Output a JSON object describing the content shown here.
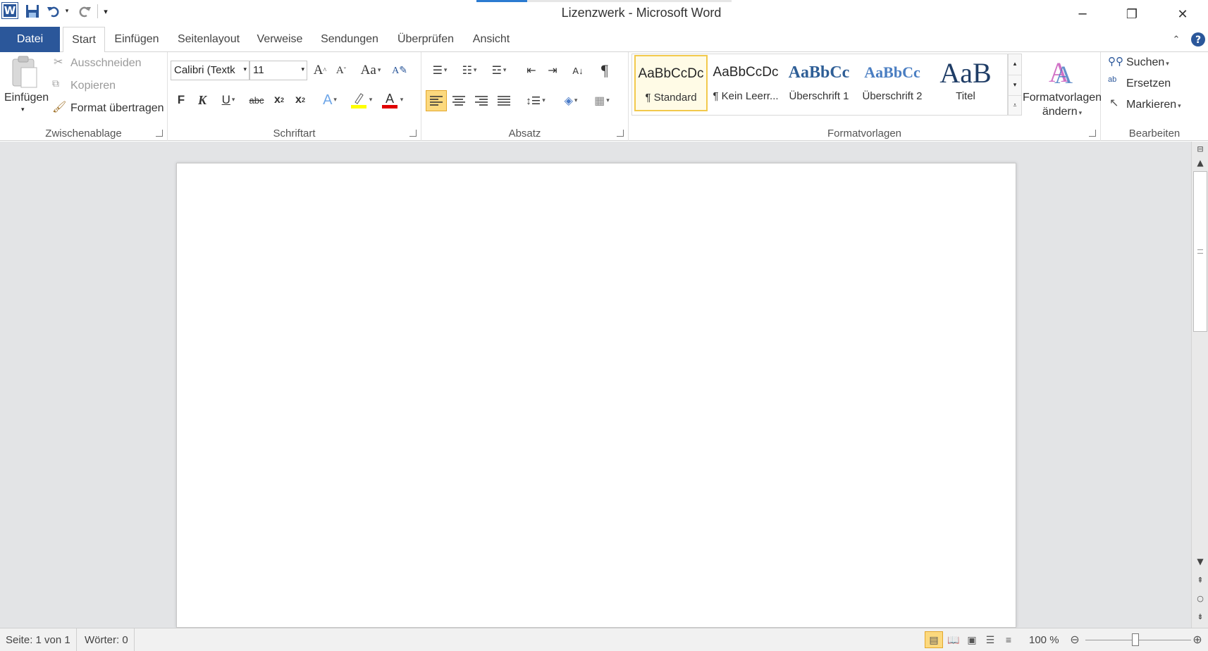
{
  "window": {
    "title": "Lizenzwerk - Microsoft Word"
  },
  "qat": {
    "logo": "W",
    "save_icon": "save-icon",
    "undo_icon": "undo-icon",
    "redo_icon": "redo-icon"
  },
  "tabs": {
    "file": "Datei",
    "items": [
      "Start",
      "Einfügen",
      "Seitenlayout",
      "Verweise",
      "Sendungen",
      "Überprüfen",
      "Ansicht"
    ],
    "active": "Start"
  },
  "clipboard": {
    "paste": "Einfügen",
    "cut": "Ausschneiden",
    "copy": "Kopieren",
    "format_painter": "Format übertragen",
    "label": "Zwischenablage"
  },
  "font": {
    "name": "Calibri (Textk",
    "size": "11",
    "label": "Schriftart",
    "bold": "F",
    "italic": "K",
    "underline": "U",
    "strike": "abc",
    "subscript": "x",
    "superscript": "x",
    "grow": "A",
    "shrink": "A",
    "case": "Aa",
    "font_color": "#e00000",
    "highlight_color": "#ffff00"
  },
  "paragraph": {
    "label": "Absatz",
    "pilcrow": "¶"
  },
  "styles": {
    "label": "Formatvorlagen",
    "items": [
      {
        "preview": "AaBbCcDc",
        "name": "¶ Standard"
      },
      {
        "preview": "AaBbCcDc",
        "name": "¶ Kein Leerr..."
      },
      {
        "preview": "AaBbCc",
        "name": "Überschrift 1"
      },
      {
        "preview": "AaBbCc",
        "name": "Überschrift 2"
      },
      {
        "preview": "AaB",
        "name": "Titel"
      }
    ],
    "change_line1": "Formatvorlagen",
    "change_line2": "ändern"
  },
  "editing": {
    "label": "Bearbeiten",
    "find": "Suchen",
    "replace": "Ersetzen",
    "select": "Markieren"
  },
  "status": {
    "page": "Seite: 1 von 1",
    "words": "Wörter: 0",
    "zoom": "100 %"
  },
  "colors": {
    "accent": "#2b579a"
  }
}
